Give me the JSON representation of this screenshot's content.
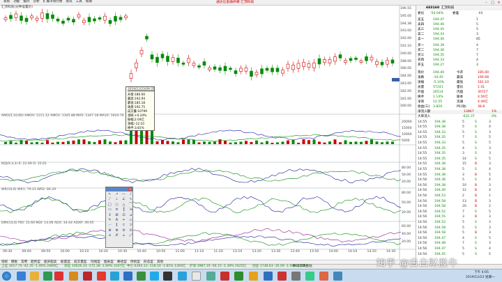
{
  "menubar": {
    "items": [
      "系统",
      "功能",
      "报价",
      "分析",
      "扩展市场行情",
      "资讯",
      "工具",
      "帮助"
    ],
    "title": "通达信金融终端 汇顶科技"
  },
  "chart": {
    "price_header": "汇顶科技(分钟设置价)",
    "price_axis": [
      "196.55",
      "195.00",
      "194.38",
      "193.00",
      "192.00",
      "191.10",
      "190.00",
      "188.00",
      "186.00",
      "184.00",
      "183.00",
      "182.00",
      "181.00",
      "180.00"
    ],
    "current_price_tag": "191.10",
    "volume_header": "AMO(5,10,60) AMOV: 1111.12 AMO1: 1345.88 MA5: 1347.18 MA10: 1924.76",
    "volume_axis": [
      "20000",
      "15000",
      "10000",
      "5000"
    ],
    "kdj_header": "KDJ(9,3,3) K: 22.69 D: 25.61",
    "kdj_axis": [
      "80.00",
      "50.00",
      "20.00"
    ],
    "wr_header": "WR(10,6) WR1: 79.21 WR2: 84.29",
    "wr_axis": [
      "80.00",
      "50.00",
      "20.00"
    ],
    "dmi_header": "DMI(14,6) PDI: 15.69 MDI: 14.06 ADX: 34.44 ADXR: 49.05",
    "dmi_axis": [
      "60.00",
      "40.00",
      "20.00"
    ],
    "time_axis": [
      "09:30",
      "09:40",
      "09:50",
      "10:00",
      "10:10",
      "10:20",
      "10:30",
      "10:40",
      "10:50",
      "11:00",
      "11:10",
      "11:20",
      "13:10",
      "13:20",
      "13:30",
      "13:40",
      "13:50",
      "14:00",
      "14:10",
      "14:20",
      "14:30"
    ]
  },
  "tooltip": {
    "date": "2019/12/23/09:35",
    "lines": [
      "开盘:180.00",
      "最高:192.94",
      "最低:185.18",
      "收盘:192.75",
      "成交量:10799",
      "涨跌:+0.24%",
      "振幅:2.04亿",
      "涨幅:-12.10",
      "换手:3.81%"
    ]
  },
  "quote": {
    "code": "603160",
    "name": "汇顶科技",
    "webi_label": "委比",
    "webi": "-54.04%",
    "weicha_label": "委差",
    "weicha": "-66",
    "asks": [
      {
        "label": "卖五",
        "price": "194.47",
        "vol": "1"
      },
      {
        "label": "卖四",
        "price": "194.46",
        "vol": "5"
      },
      {
        "label": "卖三",
        "price": "194.45",
        "vol": "5"
      },
      {
        "label": "卖二",
        "price": "194.43",
        "vol": "3"
      },
      {
        "label": "卖一",
        "price": "194.40",
        "vol": "85"
      }
    ],
    "bids": [
      {
        "label": "买一",
        "price": "194.39",
        "vol": "4"
      },
      {
        "label": "买二",
        "price": "194.36",
        "vol": "7"
      },
      {
        "label": "买三",
        "price": "194.35",
        "vol": "7"
      },
      {
        "label": "买四",
        "price": "194.33",
        "vol": "4"
      },
      {
        "label": "买五",
        "price": "194.27",
        "vol": "3"
      }
    ],
    "stats": [
      {
        "l1": "现价",
        "v1": "194.40",
        "l2": "今开",
        "v2": "185.00"
      },
      {
        "l1": "涨跌",
        "v1": "-10.45",
        "l2": "最高",
        "v2": "196.68"
      },
      {
        "l1": "涨幅",
        "v1": "-5.10%",
        "l2": "最低",
        "v2": "181.10"
      },
      {
        "l1": "总量",
        "v1": "57241",
        "l2": "量比",
        "v2": "1.41"
      },
      {
        "l1": "外盘",
        "v1": "26514",
        "l2": "内盘",
        "v2": "30727"
      },
      {
        "l1": "换手",
        "v1": "1.14%",
        "l2": "股本",
        "v2": "4.56亿"
      },
      {
        "l1": "净资",
        "v1": "12.55",
        "l2": "流通",
        "v2": "4.49亿"
      },
      {
        "l1": "收益(三)",
        "v1": "3.820",
        "l2": "PE(动)",
        "v2": "38.8"
      }
    ],
    "inflow_label": "净流入额",
    "inflow": "13867",
    "inflow_pct": "1%",
    "big_inflow_label": "大单流入",
    "big_inflow": "-631.37",
    "big_inflow_pct": "0%",
    "ticks": [
      {
        "t": "14:55",
        "p": "194.38",
        "v": "5",
        "bs": "S",
        "n": "3"
      },
      {
        "t": "14:55",
        "p": "194.38",
        "v": "5",
        "bs": "S",
        "n": "4"
      },
      {
        "t": "14:55",
        "p": "194.33",
        "v": "5",
        "bs": "S",
        "n": "3"
      },
      {
        "t": "14:55",
        "p": "194.35",
        "v": "7",
        "bs": "S",
        "n": "5"
      },
      {
        "t": "14:55",
        "p": "194.33",
        "v": "5",
        "bs": "S",
        "n": "5"
      },
      {
        "t": "14:55",
        "p": "194.35",
        "v": "4",
        "bs": "S",
        "n": "3"
      },
      {
        "t": "14:55",
        "p": "194.35",
        "v": "3",
        "bs": "S",
        "n": "3"
      },
      {
        "t": "14:55",
        "p": "194.35",
        "v": "14",
        "bs": "S",
        "n": "5"
      },
      {
        "t": "14:55",
        "p": "194.38",
        "v": "15",
        "bs": "B",
        "n": "3"
      },
      {
        "t": "14:55",
        "p": "194.38",
        "v": "5",
        "bs": "S",
        "n": "4"
      },
      {
        "t": "14:55",
        "p": "194.38",
        "v": "3",
        "bs": "B",
        "n": "5"
      },
      {
        "t": "14:56",
        "p": "194.36",
        "v": "5",
        "bs": "S",
        "n": "4"
      },
      {
        "t": "14:56",
        "p": "194.38",
        "v": "10",
        "bs": "B",
        "n": "3"
      },
      {
        "t": "14:56",
        "p": "194.40",
        "v": "12",
        "bs": "B",
        "n": "4"
      },
      {
        "t": "14:56",
        "p": "194.53",
        "v": "2",
        "bs": "B",
        "n": "1"
      },
      {
        "t": "14:56",
        "p": "194.58",
        "v": "13",
        "bs": "B",
        "n": "3"
      },
      {
        "t": "14:56",
        "p": "194.58",
        "v": "20",
        "bs": "B",
        "n": "2"
      },
      {
        "t": "14:56",
        "p": "194.52",
        "v": "7",
        "bs": "S",
        "n": "5"
      },
      {
        "t": "14:56",
        "p": "194.55",
        "v": "3",
        "bs": "B",
        "n": "3"
      },
      {
        "t": "14:56",
        "p": "194.52",
        "v": "5",
        "bs": "S",
        "n": "3"
      },
      {
        "t": "14:56",
        "p": "194.58",
        "v": "5",
        "bs": "S",
        "n": "3"
      },
      {
        "t": "14:56",
        "p": "194.58",
        "v": "5",
        "bs": "B",
        "n": "3"
      },
      {
        "t": "14:56",
        "p": "194.47",
        "v": "4",
        "bs": "S",
        "n": "5"
      },
      {
        "t": "14:56",
        "p": "194.48",
        "v": "7",
        "bs": "S",
        "n": "3"
      },
      {
        "t": "14:56",
        "p": "194.47",
        "v": "5",
        "bs": "S",
        "n": "4"
      },
      {
        "t": "14:56",
        "p": "194.45",
        "v": "5",
        "bs": "S",
        "n": "5"
      }
    ]
  },
  "bottom_tabs": [
    "指标",
    "模板",
    "常用",
    "趋势型",
    "超买超卖",
    "能量型",
    "成交量型",
    "均线型",
    "图表型",
    "路径型",
    "停损型",
    "形态型",
    "其他"
  ],
  "status": [
    {
      "txt": "上证 3017.70  -42.35  -1.40%  2489亿",
      "c": "#0a8a0a"
    },
    {
      "txt": "深证 10026.33  -172.38  -1.69%  3107亿",
      "c": "#0a8a0a"
    },
    {
      "txt": "中小 6393.13  -118.10  -1.81%  1360亿",
      "c": "#0a8a0a"
    },
    {
      "txt": "沪深 3987.19  -56.15  -1.39%  1625亿",
      "c": "#0a8a0a"
    },
    {
      "txt": "创业 1738.63  -35.09  -1.98%  1226亿",
      "c": "#0a8a0a"
    },
    {
      "txt": "移动行情主站",
      "c": "#222"
    }
  ],
  "taskbar": {
    "time": "下午 4:05",
    "date": "2019/12/23 星期一"
  },
  "watermark": "知乎 @白白财股牛"
}
